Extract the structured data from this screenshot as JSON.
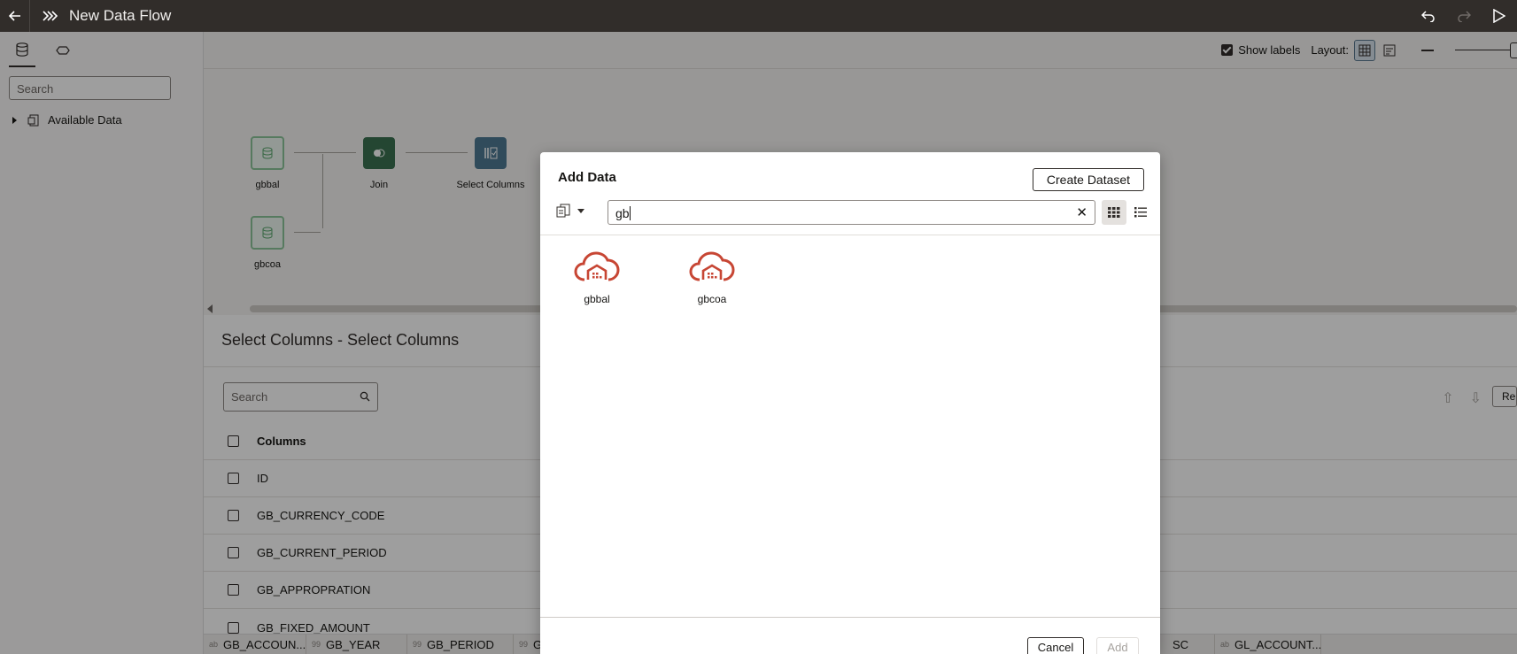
{
  "topbar": {
    "title": "New Data Flow",
    "icons": [
      "back-arrow-icon",
      "data-flow-icon",
      "undo-icon",
      "redo-icon",
      "run-icon"
    ]
  },
  "left_panel": {
    "search_placeholder": "Search",
    "tree_item": "Available Data"
  },
  "canvas": {
    "show_labels": "Show labels",
    "layout_label": "Layout:",
    "nodes": {
      "gbbal": "gbbal",
      "gbcoa": "gbcoa",
      "join": "Join",
      "select": "Select Columns"
    }
  },
  "bottom_panel": {
    "title": "Select Columns - Select Columns",
    "search_placeholder": "Search",
    "re_label": "Re",
    "header": "Columns",
    "rows": [
      "ID",
      "GB_CURRENCY_CODE",
      "GB_CURRENT_PERIOD",
      "GB_APPROPRATION",
      "GB_FIXED_AMOUNT"
    ]
  },
  "status_bar": {
    "chips": [
      {
        "prefix": "ab",
        "label": "GB_ACCOUN..."
      },
      {
        "prefix": "99",
        "label": "GB_YEAR"
      },
      {
        "prefix": "99",
        "label": "GB_PERIOD"
      },
      {
        "prefix": "99",
        "label": "G"
      },
      {
        "prefix": "",
        "label": "SC"
      },
      {
        "prefix": "ab",
        "label": "GL_ACCOUNT..."
      }
    ]
  },
  "dialog": {
    "title": "Add Data",
    "create_button": "Create Dataset",
    "search_value": "gb",
    "results": [
      {
        "name": "gbbal",
        "icon": "cloud-database-icon",
        "color": "#c74634"
      },
      {
        "name": "gbcoa",
        "icon": "cloud-database-icon",
        "color": "#c74634"
      }
    ],
    "cancel_button": "Cancel",
    "add_button": "Add"
  }
}
